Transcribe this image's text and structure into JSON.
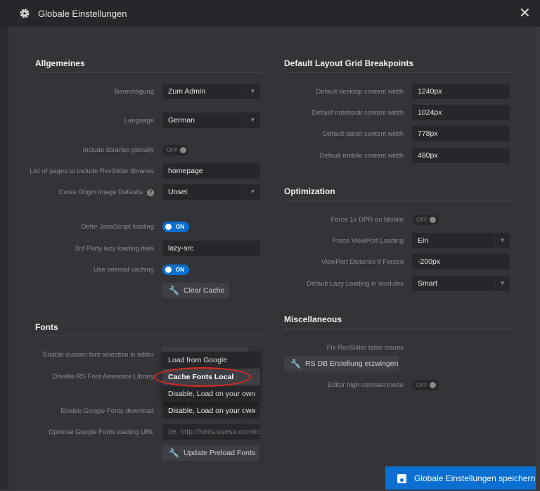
{
  "header": {
    "title": "Globale Einstellungen",
    "close": "✕"
  },
  "general": {
    "heading": "Allgemeines",
    "berechtigung": {
      "label": "Berechtigung",
      "value": "Zum Admin"
    },
    "language": {
      "label": "Language",
      "value": "German"
    },
    "include_libs": {
      "label": "Include libraries globally",
      "state": "OFF"
    },
    "pages": {
      "label": "List of pages to include RevSlider libraries",
      "value": "homepage"
    },
    "cross_origin": {
      "label": "Cross Origin Image Defaults",
      "value": "Unset",
      "help": "?"
    },
    "defer": {
      "label": "Defer JavaScript loading",
      "state": "ON"
    },
    "lazy3rd": {
      "label": "3rd Party lazy loading data",
      "value": "lazy-src"
    },
    "caching": {
      "label": "Use internal caching",
      "state": "ON"
    },
    "clear_cache": "Clear Cache"
  },
  "fonts": {
    "heading": "Fonts",
    "custom_font": {
      "label": "Enable custom font selection in editor"
    },
    "disable_fa": {
      "label": "Disable RS Font Awesome Library"
    },
    "google_download": {
      "label": "Enable Google Fonts download",
      "value": "Disable, Load on your own"
    },
    "url": {
      "label": "Optional Google Fonts loading URL",
      "placeholder": "(ie. http://fonts.useso.com/css?family="
    },
    "update_preload": "Update Preload Fonts",
    "dropdown_options": [
      "Load from Google",
      "Cache Fonts Local",
      "Disable, Load on your own"
    ]
  },
  "grid": {
    "heading": "Default Layout Grid Breakpoints",
    "rows": [
      {
        "label": "Default desktop content width",
        "value": "1240px"
      },
      {
        "label": "Default notebook content width",
        "value": "1024px"
      },
      {
        "label": "Default tablet content width",
        "value": "778px"
      },
      {
        "label": "Default mobile content width",
        "value": "480px"
      }
    ]
  },
  "optimization": {
    "heading": "Optimization",
    "dpr": {
      "label": "Force 1x DPR on Mobile",
      "state": "OFF"
    },
    "viewport": {
      "label": "Force ViewPort Loading",
      "value": "Ein"
    },
    "distance": {
      "label": "ViewPort Distance if Forced",
      "value": "-200px"
    },
    "lazy": {
      "label": "Default Lazy Loading in modules",
      "value": "Smart"
    }
  },
  "misc": {
    "heading": "Miscellaneous",
    "fix_label": "Fix RevSlider table issues",
    "fix_button": "RS DB Erstellung erzwingen",
    "contrast": {
      "label": "Editor high contrast mode",
      "state": "OFF"
    }
  },
  "save_button": "Globale Einstellungen speichern",
  "colors": {
    "accent": "#0a6fd0",
    "highlight": "#e5261c"
  }
}
